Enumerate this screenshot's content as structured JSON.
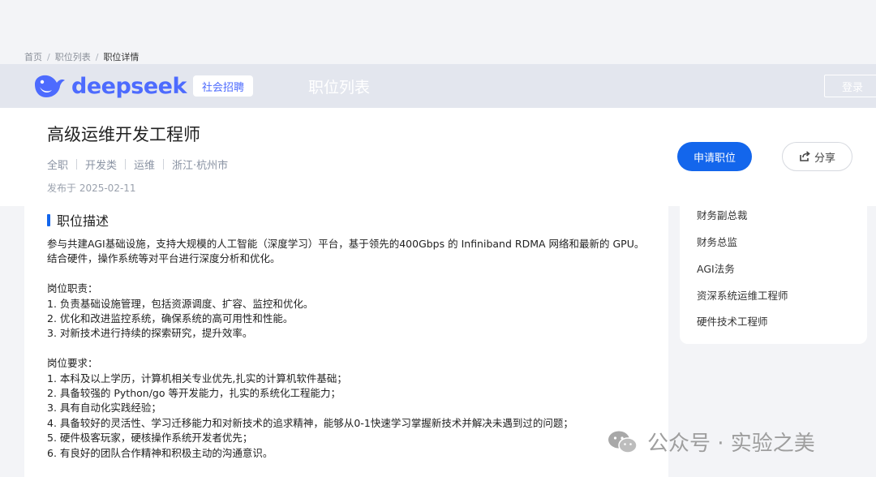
{
  "breadcrumb": {
    "items": [
      "首页",
      "职位列表",
      "职位详情"
    ],
    "separator": "/"
  },
  "header": {
    "logo_text": "deepseek",
    "badge": "社会招聘",
    "nav_jobs": "职位列表",
    "login": "登录",
    "brand_color": "#4d6bfe"
  },
  "job": {
    "title": "高级运维开发工程师",
    "meta": [
      "全职",
      "开发类",
      "运维",
      "浙江·杭州市"
    ],
    "publish_date": "发布于 2025-02-11",
    "apply_label": "申请职位",
    "share_label": "分享",
    "accent_color": "#1366ec"
  },
  "description": {
    "section_title": "职位描述",
    "lines": [
      "参与共建AGI基础设施，支持大规模的人工智能（深度学习）平台，基于领先的400Gbps 的 Infiniband RDMA 网络和最新的 GPU。",
      "结合硬件，操作系统等对平台进行深度分析和优化。",
      "",
      "岗位职责：",
      "1. 负责基础设施管理，包括资源调度、扩容、监控和优化。",
      "2. 优化和改进监控系统，确保系统的高可用性和性能。",
      "3. 对新技术进行持续的探索研究，提升效率。",
      "",
      "岗位要求：",
      "1. 本科及以上学历，计算机相关专业优先,扎实的计算机软件基础；",
      "2. 具备较强的 Python/go 等开发能力，扎实的系统化工程能力；",
      "3. 具有自动化实践经验；",
      "4. 具备较好的灵活性、学习迁移能力和对新技术的追求精神，能够从0-1快速学习掌握新技术并解决未遇到过的问题；",
      "5. 硬件极客玩家，硬核操作系统开发者优先；",
      "6. 有良好的团队合作精神和积极主动的沟通意识。"
    ]
  },
  "sidebar": {
    "items": [
      "财务副总裁",
      "财务总监",
      "AGI法务",
      "资深系统运维工程师",
      "硬件技术工程师"
    ]
  },
  "watermark": {
    "text": "公众号 · 实验之美"
  }
}
